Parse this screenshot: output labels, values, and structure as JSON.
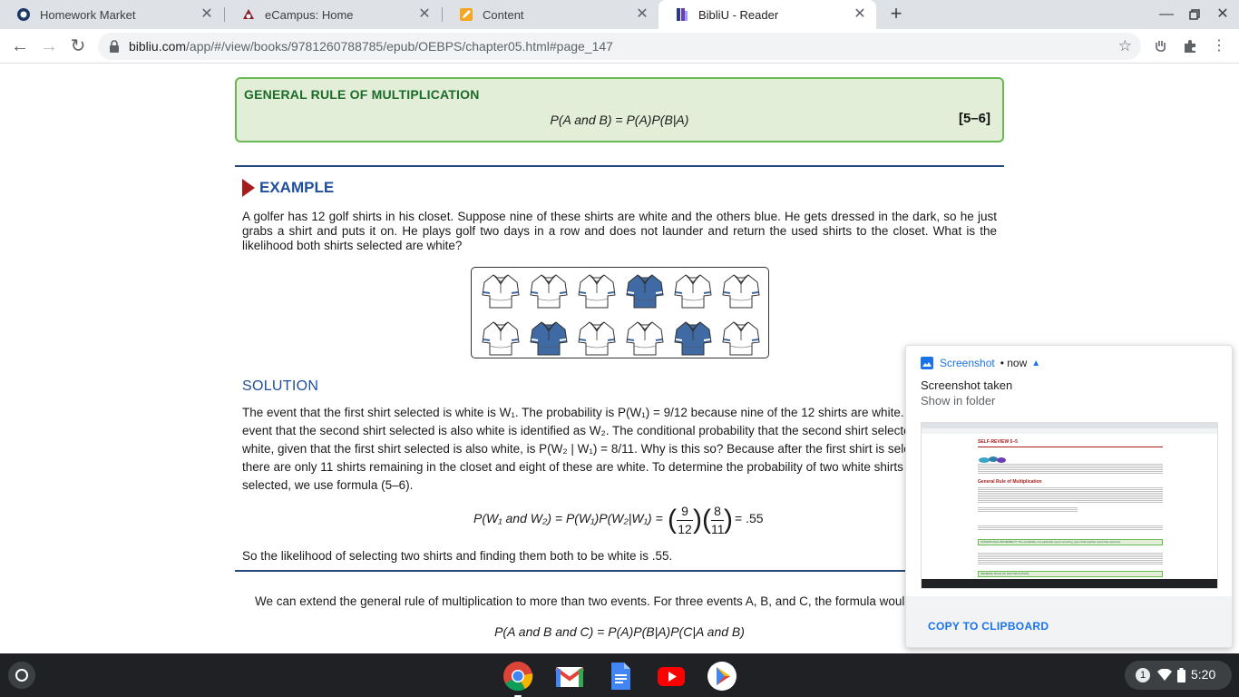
{
  "tabs": [
    {
      "title": "Homework Market",
      "active": false
    },
    {
      "title": "eCampus: Home",
      "active": false
    },
    {
      "title": "Content",
      "active": false
    },
    {
      "title": "BibliU - Reader",
      "active": true
    }
  ],
  "omnibox": {
    "host": "bibliu.com",
    "path": "/app/#/view/books/9781260788785/epub/OEBPS/chapter05.html#page_147"
  },
  "rule": {
    "title": "GENERAL RULE OF MULTIPLICATION",
    "formula": "P(A and B) = P(A)P(B|A)",
    "number": "[5–6]"
  },
  "example": {
    "heading": "EXAMPLE",
    "text": "A golfer has 12 golf shirts in his closet. Suppose nine of these shirts are white and the others blue. He gets dressed in the dark, so he just grabs a shirt and puts it on. He plays golf two days in a row and does not launder and return the used shirts to the closet. What is the likelihood both shirts selected are white?",
    "shirts": [
      "white",
      "white",
      "white",
      "blue",
      "white",
      "white",
      "white",
      "blue",
      "white",
      "white",
      "blue",
      "white"
    ]
  },
  "solution": {
    "heading": "SOLUTION",
    "lines": [
      "The event that the first shirt selected is white is W₁. The probability is P(W₁) = 9/12 because nine of the 12 shirts are white. The",
      "event that the second shirt selected is also white is identified as W₂. The conditional probability that the second shirt selected is",
      "white, given that the first shirt selected is also white, is P(W₂ | W₁) = 8/11. Why is this so? Because after the first shirt is selected,",
      "there are only 11 shirts remaining in the closet and eight of these are white. To determine the probability of two white shirts being",
      "selected, we use formula (5–6)."
    ],
    "equation": {
      "lhs": "P(W₁ and W₂) = P(W₁)P(W₂|W₁) =",
      "f1_num": "9",
      "f1_den": "12",
      "f2_num": "8",
      "f2_den": "11",
      "result": "= .55"
    },
    "conclusion": "So the likelihood of selecting two shirts and finding them both to be white is .55."
  },
  "extend": {
    "text": "We can extend the general rule of multiplication to more than two events. For three events A, B, and C, the formula would be:",
    "formula": "P(A and B and C) = P(A)P(B|A)P(C|A and B)"
  },
  "notification": {
    "app": "Screenshot",
    "time": "• now",
    "title": "Screenshot taken",
    "subtitle": "Show in folder",
    "action": "COPY TO CLIPBOARD"
  },
  "thumbnail": {
    "heading": "SELF-REVIEW 5–5",
    "section": "General Rule of Multiplication",
    "box1": "CONDITIONAL PROBABILITY  The probability of a particular event occurring, given that another event has occurred.",
    "box2": "GENERAL RULE OF MULTIPLICATION"
  },
  "shelf": {
    "badge": "1",
    "time": "5:20"
  },
  "colors": {
    "rule_fill": "#e2eed8",
    "rule_border": "#69b954",
    "heading_blue": "#1f4e9b",
    "accent_red": "#a31d1d",
    "shirt_blue": "#3f6aa3"
  }
}
